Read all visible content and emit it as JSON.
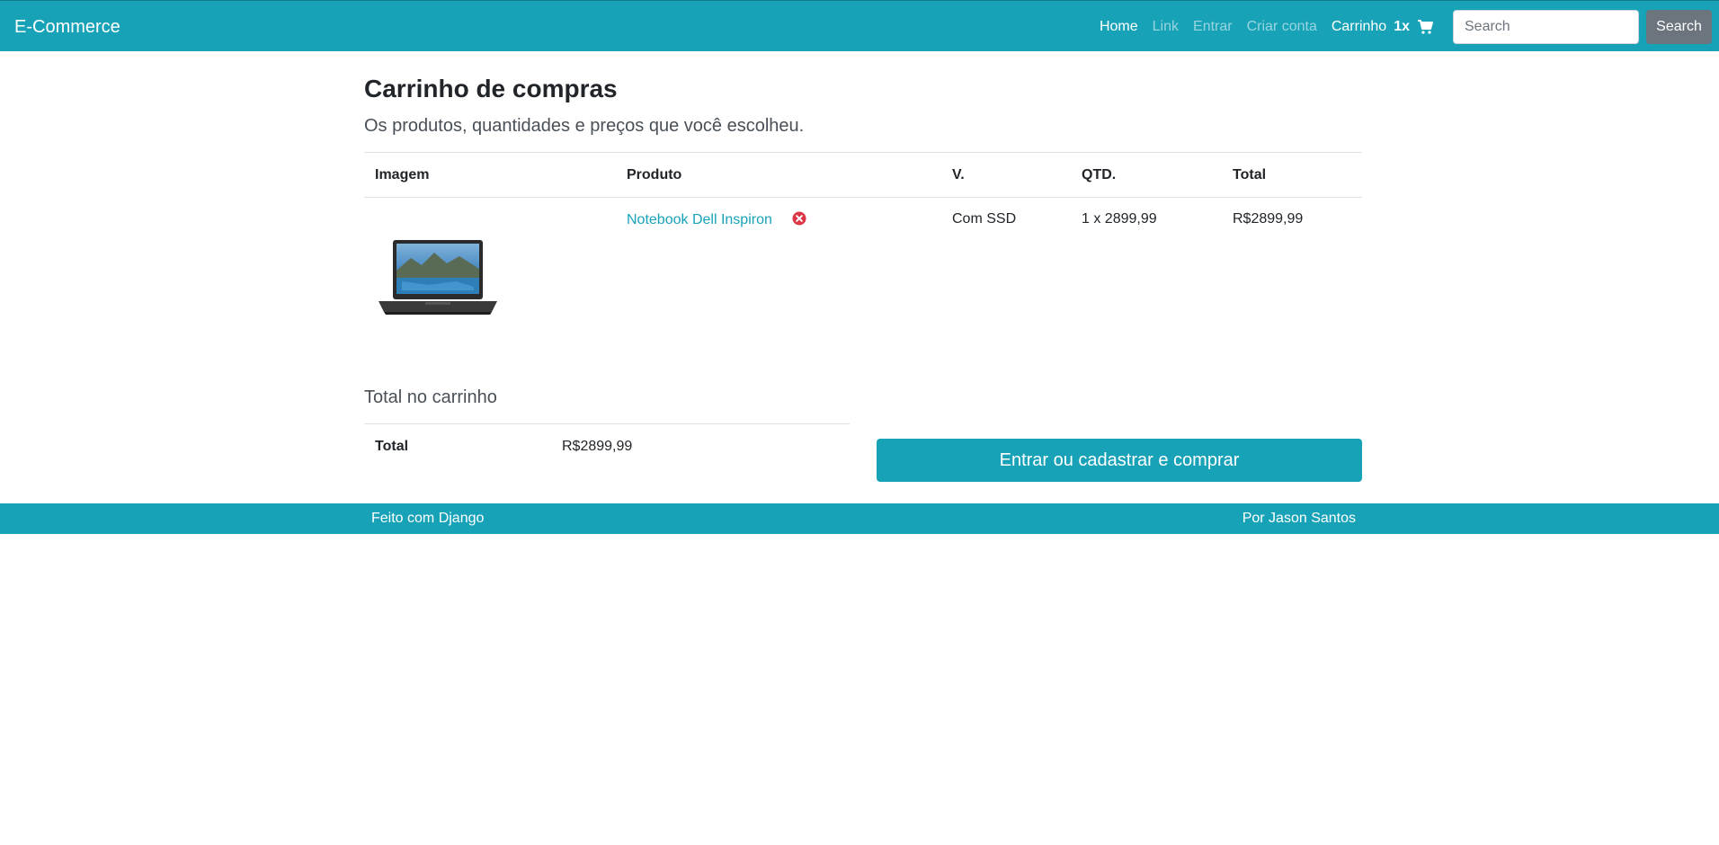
{
  "navbar": {
    "brand": "E-Commerce",
    "links": [
      "Home",
      "Link",
      "Entrar",
      "Criar conta"
    ],
    "cart_label": "Carrinho",
    "cart_count": "1x",
    "search_placeholder": "Search",
    "search_button": "Search",
    "color": "#17a2b8"
  },
  "page": {
    "title": "Carrinho de compras",
    "subtitle": "Os produtos, quantidades e preços que você escolheu."
  },
  "table": {
    "headers": [
      "Imagem",
      "Produto",
      "V.",
      "QTD.",
      "Total"
    ],
    "rows": [
      {
        "product": "Notebook Dell Inspiron",
        "variation": "Com SSD",
        "quantity": "1 x 2899,99",
        "total": "R$2899,99"
      }
    ]
  },
  "summary": {
    "title": "Total no carrinho",
    "label": "Total",
    "value": "R$2899,99",
    "checkout_button": "Entrar ou cadastrar e comprar"
  },
  "footer": {
    "left": "Feito com Django",
    "right": "Por Jason Santos"
  },
  "icons": {
    "cart": "shopping-cart-icon",
    "remove": "times-circle-icon",
    "remove_color": "#dc3545"
  }
}
